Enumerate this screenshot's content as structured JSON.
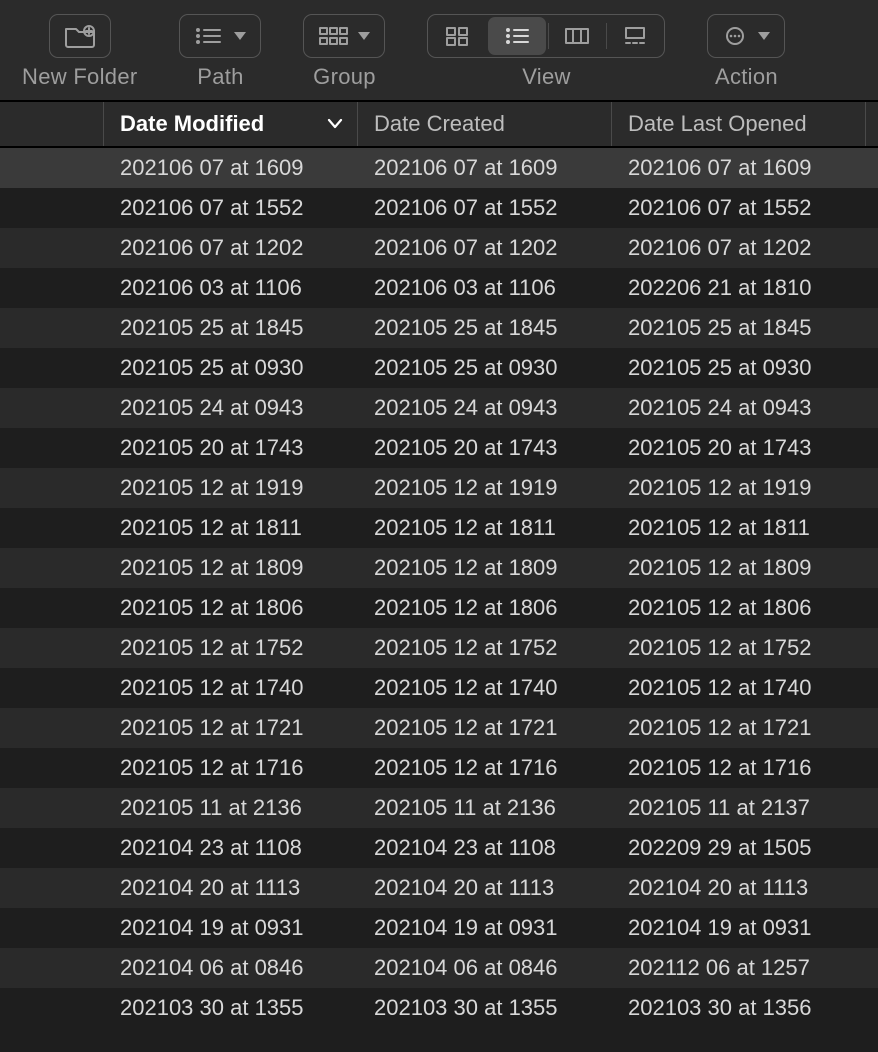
{
  "toolbar": {
    "new_folder_label": "New Folder",
    "path_label": "Path",
    "group_label": "Group",
    "view_label": "View",
    "action_label": "Action",
    "view_active_index": 1
  },
  "columns": {
    "modified": "Date Modified",
    "created": "Date Created",
    "opened": "Date Last Opened",
    "sort_column": "modified",
    "sort_direction": "desc"
  },
  "rows": [
    {
      "selected": true,
      "modified": "202106 07 at 1609",
      "created": "202106 07 at 1609",
      "opened": "202106 07 at 1609"
    },
    {
      "selected": false,
      "modified": "202106 07 at 1552",
      "created": "202106 07 at 1552",
      "opened": "202106 07 at 1552"
    },
    {
      "selected": false,
      "modified": "202106 07 at 1202",
      "created": "202106 07 at 1202",
      "opened": "202106 07 at 1202"
    },
    {
      "selected": false,
      "modified": "202106 03 at 1106",
      "created": "202106 03 at 1106",
      "opened": "202206 21 at 1810"
    },
    {
      "selected": false,
      "modified": "202105 25 at 1845",
      "created": "202105 25 at 1845",
      "opened": "202105 25 at 1845"
    },
    {
      "selected": false,
      "modified": "202105 25 at 0930",
      "created": "202105 25 at 0930",
      "opened": "202105 25 at 0930"
    },
    {
      "selected": false,
      "modified": "202105 24 at 0943",
      "created": "202105 24 at 0943",
      "opened": "202105 24 at 0943"
    },
    {
      "selected": false,
      "modified": "202105 20 at 1743",
      "created": "202105 20 at 1743",
      "opened": "202105 20 at 1743"
    },
    {
      "selected": false,
      "modified": "202105 12 at 1919",
      "created": "202105 12 at 1919",
      "opened": "202105 12 at 1919"
    },
    {
      "selected": false,
      "modified": "202105 12 at 1811",
      "created": "202105 12 at 1811",
      "opened": "202105 12 at 1811"
    },
    {
      "selected": false,
      "modified": "202105 12 at 1809",
      "created": "202105 12 at 1809",
      "opened": "202105 12 at 1809"
    },
    {
      "selected": false,
      "modified": "202105 12 at 1806",
      "created": "202105 12 at 1806",
      "opened": "202105 12 at 1806"
    },
    {
      "selected": false,
      "modified": "202105 12 at 1752",
      "created": "202105 12 at 1752",
      "opened": "202105 12 at 1752"
    },
    {
      "selected": false,
      "modified": "202105 12 at 1740",
      "created": "202105 12 at 1740",
      "opened": "202105 12 at 1740"
    },
    {
      "selected": false,
      "modified": "202105 12 at 1721",
      "created": "202105 12 at 1721",
      "opened": "202105 12 at 1721"
    },
    {
      "selected": false,
      "modified": "202105 12 at 1716",
      "created": "202105 12 at 1716",
      "opened": "202105 12 at 1716"
    },
    {
      "selected": false,
      "modified": "202105 11 at 2136",
      "created": "202105 11 at 2136",
      "opened": "202105 11 at 2137"
    },
    {
      "selected": false,
      "modified": "202104 23 at 1108",
      "created": "202104 23 at 1108",
      "opened": "202209 29 at 1505"
    },
    {
      "selected": false,
      "modified": "202104 20 at 1113",
      "created": "202104 20 at 1113",
      "opened": "202104 20 at 1113"
    },
    {
      "selected": false,
      "modified": "202104 19 at 0931",
      "created": "202104 19 at 0931",
      "opened": "202104 19 at 0931"
    },
    {
      "selected": false,
      "modified": "202104 06 at 0846",
      "created": "202104 06 at 0846",
      "opened": "202112 06 at 1257"
    },
    {
      "selected": false,
      "modified": "202103 30 at 1355",
      "created": "202103 30 at 1355",
      "opened": "202103 30 at 1356"
    }
  ]
}
